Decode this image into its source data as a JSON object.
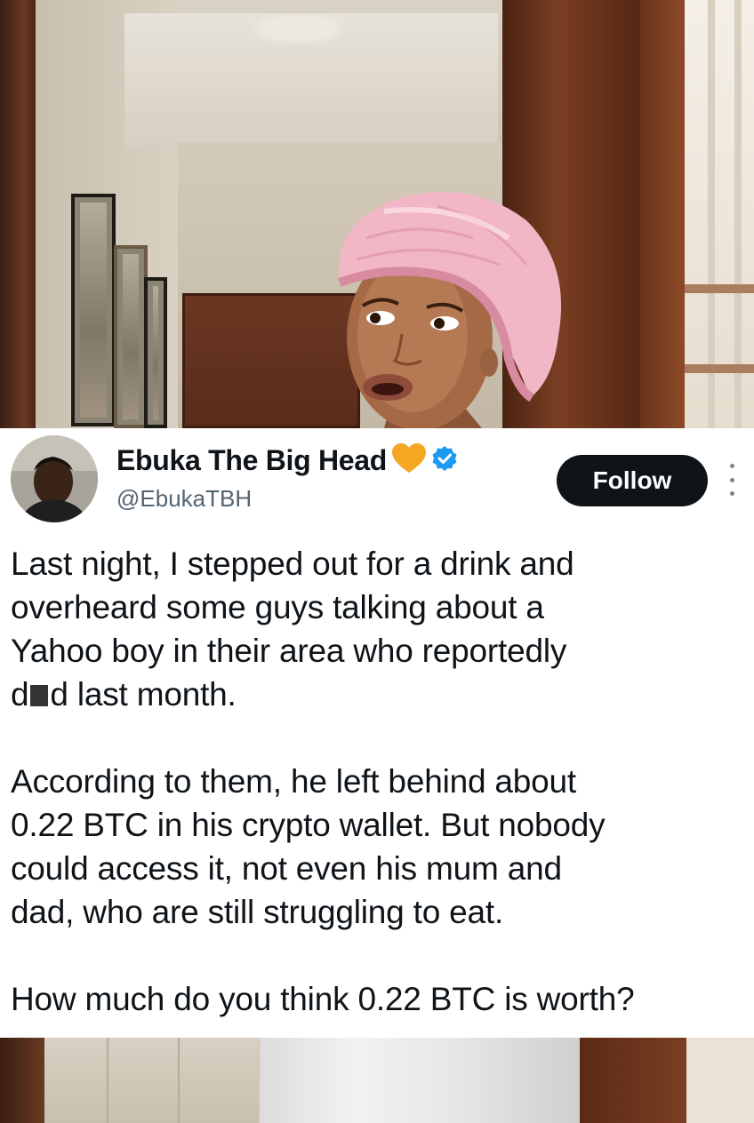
{
  "tweet": {
    "display_name": "Ebuka The Big Head",
    "handle": "@EbukaTBH",
    "follow_label": "Follow",
    "badges": {
      "heart_color": "#f5a623",
      "verified_color": "#1d9bf0"
    },
    "paragraph_1_before": "Last night, I stepped out for a drink and\noverheard some guys talking about a\nYahoo boy in their area who reportedly\nd",
    "paragraph_1_after": "d last month.",
    "paragraph_2": "According to them, he left behind about\n0.22 BTC in his crypto wallet. But nobody\ncould access it, not even his mum and\ndad, who are still struggling to eat.",
    "paragraph_3": "How much do you think 0.22 BTC is worth?"
  },
  "icons": {
    "heart": "orange-heart-icon",
    "verified": "verified-badge-icon",
    "more": "more-options-icon"
  }
}
